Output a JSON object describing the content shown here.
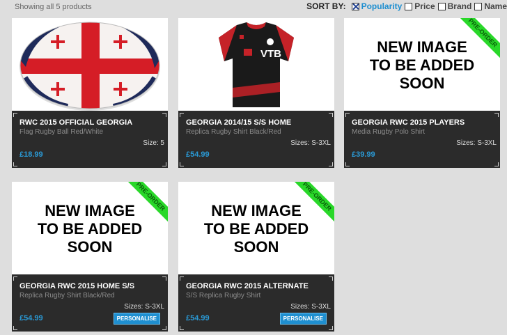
{
  "listing": {
    "count_text": "Showing all 5 products"
  },
  "sort": {
    "title": "SORT BY:",
    "options": [
      {
        "label": "Popularity",
        "checked": true
      },
      {
        "label": "Price",
        "checked": false
      },
      {
        "label": "Brand",
        "checked": false
      },
      {
        "label": "Name",
        "checked": false
      }
    ]
  },
  "placeholder_text": [
    "NEW IMAGE",
    "TO BE ADDED",
    "SOON"
  ],
  "ribbon_text": "PRE-ORDER",
  "personalise_label": "PERSONALISE",
  "products": [
    {
      "name": "RWC 2015 OFFICIAL GEORGIA",
      "desc": "Flag Rugby Ball Red/White",
      "size": "Size: 5",
      "price": "£18.99",
      "image": "rugby-ball"
    },
    {
      "name": "GEORGIA 2014/15 S/S HOME",
      "desc": "Replica Rugby Shirt Black/Red",
      "size": "Sizes: S-3XL",
      "price": "£54.99",
      "image": "rugby-shirt",
      "shirt_sponsor": "VTB"
    },
    {
      "name": "GEORGIA RWC 2015 PLAYERS",
      "desc": "Media Rugby Polo Shirt",
      "size": "Sizes: S-3XL",
      "price": "£39.99",
      "image": "placeholder",
      "preorder": true
    },
    {
      "name": "GEORGIA RWC 2015 HOME S/S",
      "desc": "Replica Rugby Shirt Black/Red",
      "size": "Sizes: S-3XL",
      "price": "£54.99",
      "image": "placeholder",
      "preorder": true,
      "personalise": true
    },
    {
      "name": "GEORGIA RWC 2015 ALTERNATE",
      "desc": "S/S Replica Rugby Shirt",
      "size": "Sizes: S-3XL",
      "price": "£54.99",
      "image": "placeholder",
      "preorder": true,
      "personalise": true
    }
  ],
  "colors": {
    "accent": "#1f8fd0",
    "card_bg": "#2b2b2b",
    "ribbon": "#29d829",
    "page_bg": "#dedede"
  }
}
